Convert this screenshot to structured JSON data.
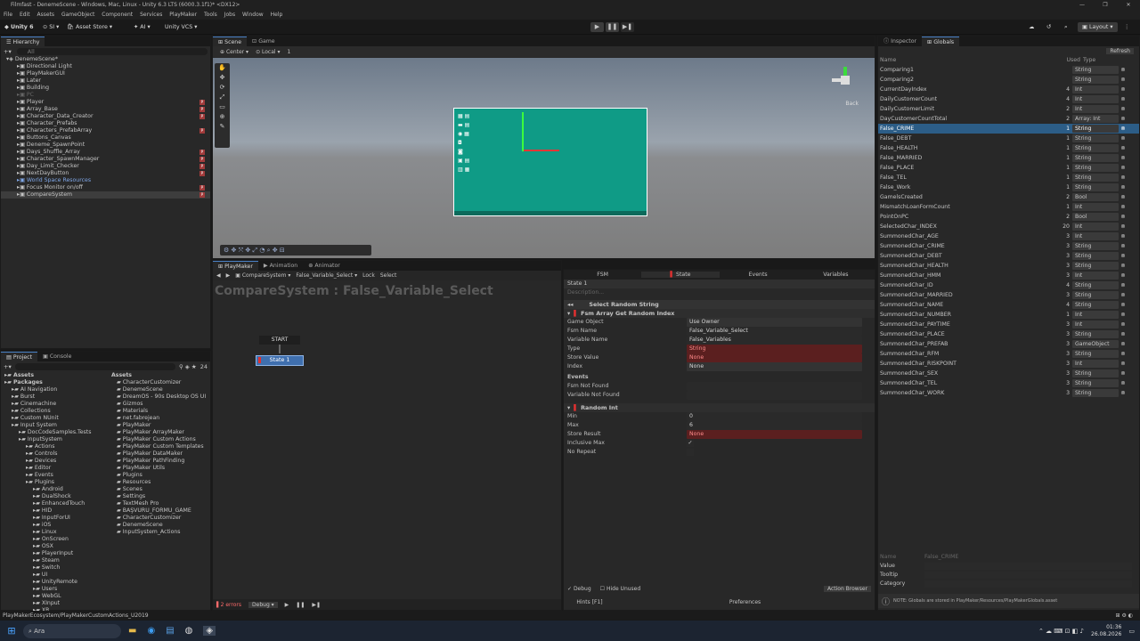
{
  "window": {
    "title": "Filmfast - DenemeScene - Windows, Mac, Linux - Unity 6.3 LTS (6000.3.1f1)* <DX12>",
    "controls": [
      "—",
      "❐",
      "✕"
    ]
  },
  "menu": [
    "File",
    "Edit",
    "Assets",
    "GameObject",
    "Component",
    "Services",
    "PlayMaker",
    "Tools",
    "Jobs",
    "Window",
    "Help"
  ],
  "toolbar": {
    "unity_label": "Unity 6",
    "si_label": "SI",
    "asset_store": "Asset Store",
    "ai_label": "AI",
    "vcs_label": "Unity VCS",
    "layout_label": "Layout"
  },
  "hierarchy": {
    "tab": "Hierarchy",
    "search_placeholder": "All",
    "items": [
      {
        "label": "DenemeScene*",
        "level": 0,
        "pm": false
      },
      {
        "label": "Directional Light",
        "level": 1,
        "pm": false
      },
      {
        "label": "PlayMakerGUI",
        "level": 1,
        "pm": false
      },
      {
        "label": "Later",
        "level": 1,
        "pm": false
      },
      {
        "label": "Building",
        "level": 1,
        "pm": false
      },
      {
        "label": "PC",
        "level": 1,
        "pm": false
      },
      {
        "label": "Player",
        "level": 1,
        "pm": true
      },
      {
        "label": "Array_Base",
        "level": 1,
        "pm": true
      },
      {
        "label": "Character_Data_Creator",
        "level": 1,
        "pm": true
      },
      {
        "label": "Character_Prefabs",
        "level": 1,
        "pm": false
      },
      {
        "label": "Characters_PrefabArray",
        "level": 1,
        "pm": true
      },
      {
        "label": "Buttons_Canvas",
        "level": 1,
        "pm": false
      },
      {
        "label": "Deneme_SpawnPoint",
        "level": 1,
        "pm": false
      },
      {
        "label": "Days_Shuffle_Array",
        "level": 1,
        "pm": true
      },
      {
        "label": "Character_SpawnManager",
        "level": 1,
        "pm": true
      },
      {
        "label": "Day_Limit_Checker",
        "level": 1,
        "pm": true
      },
      {
        "label": "NextDayButton",
        "level": 1,
        "pm": true
      },
      {
        "label": "World Space Resources",
        "level": 1,
        "pm": false
      },
      {
        "label": "Focus Monitor on/off",
        "level": 1,
        "pm": true
      },
      {
        "label": "CompareSystem",
        "level": 1,
        "pm": true
      }
    ]
  },
  "scene": {
    "tabs": [
      "Scene",
      "Game"
    ],
    "pivot": "Center",
    "space": "Local",
    "grid_num": "1",
    "back_label": "Back"
  },
  "playmaker": {
    "tabs": [
      "PlayMaker",
      "Animation",
      "Animator"
    ],
    "breadcrumb": [
      "CompareSystem",
      "False_Variable_Select",
      "Lock",
      "Select"
    ],
    "graph_title": "CompareSystem : False_Variable_Select",
    "start_label": "START",
    "state_label": "State 1",
    "errors": "2 errors",
    "debug": "Debug",
    "inspector_tabs": [
      "FSM",
      "State",
      "Events",
      "Variables"
    ],
    "state_name": "State 1",
    "description_placeholder": "Description...",
    "action1_title": "Select Random String",
    "action2_title": "Fsm Array Get Random Index",
    "props": [
      {
        "label": "Game Object",
        "value": "Use Owner",
        "style": "gray"
      },
      {
        "label": "Fsm Name",
        "value": "False_Variable_Select",
        "style": ""
      },
      {
        "label": "Variable Name",
        "value": "False_Variables",
        "style": ""
      },
      {
        "label": "Type",
        "value": "String",
        "style": "red"
      },
      {
        "label": "Store Value",
        "value": "None",
        "style": "red"
      },
      {
        "label": "Index",
        "value": "None",
        "style": "gray"
      }
    ],
    "events_label": "Events",
    "event_props": [
      {
        "label": "Fsm Not Found",
        "value": ""
      },
      {
        "label": "Variable Not Found",
        "value": ""
      }
    ],
    "action3_title": "Random Int",
    "random_props": [
      {
        "label": "Min",
        "value": "0",
        "style": ""
      },
      {
        "label": "Max",
        "value": "6",
        "style": ""
      },
      {
        "label": "Store Result",
        "value": "None",
        "style": "red"
      },
      {
        "label": "Inclusive Max",
        "value": "✓",
        "style": "check"
      },
      {
        "label": "No Repeat",
        "value": "",
        "style": "check"
      }
    ],
    "debug_label": "Debug",
    "hide_unused": "Hide Unused",
    "action_browser": "Action Browser",
    "hints": "Hints [F1]",
    "preferences": "Preferences"
  },
  "project": {
    "tabs": [
      "Project",
      "Console"
    ],
    "count": "24",
    "tree": [
      {
        "label": "Assets",
        "level": 0,
        "bold": true
      },
      {
        "label": "Packages",
        "level": 0,
        "bold": true
      },
      {
        "label": "AI Navigation",
        "level": 1
      },
      {
        "label": "Burst",
        "level": 1
      },
      {
        "label": "Cinemachine",
        "level": 1
      },
      {
        "label": "Collections",
        "level": 1
      },
      {
        "label": "Custom NUnit",
        "level": 1
      },
      {
        "label": "Input System",
        "level": 1
      },
      {
        "label": "DocCodeSamples.Tests",
        "level": 2
      },
      {
        "label": "InputSystem",
        "level": 2
      },
      {
        "label": "Actions",
        "level": 3
      },
      {
        "label": "Controls",
        "level": 3
      },
      {
        "label": "Devices",
        "level": 3
      },
      {
        "label": "Editor",
        "level": 3
      },
      {
        "label": "Events",
        "level": 3
      },
      {
        "label": "Plugins",
        "level": 3
      },
      {
        "label": "Android",
        "level": 4
      },
      {
        "label": "DualShock",
        "level": 4
      },
      {
        "label": "EnhancedTouch",
        "level": 4
      },
      {
        "label": "HID",
        "level": 4
      },
      {
        "label": "InputForUI",
        "level": 4
      },
      {
        "label": "iOS",
        "level": 4
      },
      {
        "label": "Linux",
        "level": 4
      },
      {
        "label": "OnScreen",
        "level": 4
      },
      {
        "label": "OSX",
        "level": 4
      },
      {
        "label": "PlayerInput",
        "level": 4
      },
      {
        "label": "Steam",
        "level": 4
      },
      {
        "label": "Switch",
        "level": 4
      },
      {
        "label": "UI",
        "level": 4
      },
      {
        "label": "UnityRemote",
        "level": 4
      },
      {
        "label": "Users",
        "level": 4
      },
      {
        "label": "WebGL",
        "level": 4
      },
      {
        "label": "XInput",
        "level": 4
      },
      {
        "label": "XR",
        "level": 4
      }
    ],
    "assets_header": "Assets",
    "assets": [
      "CharacterCustomizer",
      "DenemeScene",
      "DreamOS - 90s Desktop OS UI",
      "Gizmos",
      "Materials",
      "net.fabrejean",
      "PlayMaker",
      "PlayMaker ArrayMaker",
      "PlayMaker Custom Actions",
      "PlayMaker Custom Templates",
      "PlayMaker DataMaker",
      "PlayMaker PathFinding",
      "PlayMaker Utils",
      "Plugins",
      "Resources",
      "Scenes",
      "Settings",
      "TextMesh Pro",
      "BAŞVURU_FORMU_GAME",
      "CharacterCustomizer",
      "DenemeScene",
      "InputSystem_Actions"
    ]
  },
  "inspector": {
    "tabs": [
      "Inspector",
      "Globals"
    ],
    "refresh": "Refresh",
    "headers": {
      "name": "Name",
      "used": "Used",
      "type": "Type"
    },
    "globals": [
      {
        "name": "Comparing1",
        "used": "",
        "type": "String"
      },
      {
        "name": "Comparing2",
        "used": "",
        "type": "String"
      },
      {
        "name": "CurrentDayIndex",
        "used": "4",
        "type": "Int"
      },
      {
        "name": "DailyCustomerCount",
        "used": "4",
        "type": "Int"
      },
      {
        "name": "DailyCustomerLimit",
        "used": "2",
        "type": "Int"
      },
      {
        "name": "DayCustomerCountTotal",
        "used": "2",
        "type": "Array: Int"
      },
      {
        "name": "False_CRIME",
        "used": "1",
        "type": "String",
        "selected": true
      },
      {
        "name": "False_DEBT",
        "used": "1",
        "type": "String"
      },
      {
        "name": "False_HEALTH",
        "used": "1",
        "type": "String"
      },
      {
        "name": "False_MARRIED",
        "used": "1",
        "type": "String"
      },
      {
        "name": "False_PLACE",
        "used": "1",
        "type": "String"
      },
      {
        "name": "False_TEL",
        "used": "1",
        "type": "String"
      },
      {
        "name": "False_Work",
        "used": "1",
        "type": "String"
      },
      {
        "name": "GamelsCreated",
        "used": "2",
        "type": "Bool"
      },
      {
        "name": "MismatchLoanFormCount",
        "used": "1",
        "type": "Int"
      },
      {
        "name": "PointOnPC",
        "used": "2",
        "type": "Bool"
      },
      {
        "name": "SelectedChar_INDEX",
        "used": "20",
        "type": "Int"
      },
      {
        "name": "SummonedChar_AGE",
        "used": "3",
        "type": "Int"
      },
      {
        "name": "SummonedChar_CRIME",
        "used": "3",
        "type": "String"
      },
      {
        "name": "SummonedChar_DEBT",
        "used": "3",
        "type": "String"
      },
      {
        "name": "SummonedChar_HEALTH",
        "used": "3",
        "type": "String"
      },
      {
        "name": "SummonedChar_HMM",
        "used": "3",
        "type": "Int"
      },
      {
        "name": "SummonedChar_ID",
        "used": "4",
        "type": "String"
      },
      {
        "name": "SummonedChar_MARRIED",
        "used": "3",
        "type": "String"
      },
      {
        "name": "SummonedChar_NAME",
        "used": "4",
        "type": "String"
      },
      {
        "name": "SummonedChar_NUMBER",
        "used": "1",
        "type": "Int"
      },
      {
        "name": "SummonedChar_PAYTIME",
        "used": "3",
        "type": "Int"
      },
      {
        "name": "SummonedChar_PLACE",
        "used": "3",
        "type": "String"
      },
      {
        "name": "SummonedChar_PREFAB",
        "used": "3",
        "type": "GameObject"
      },
      {
        "name": "SummonedChar_RFM",
        "used": "3",
        "type": "String"
      },
      {
        "name": "SummonedChar_RISKPOINT",
        "used": "3",
        "type": "Int"
      },
      {
        "name": "SummonedChar_SEX",
        "used": "3",
        "type": "String"
      },
      {
        "name": "SummonedChar_TEL",
        "used": "3",
        "type": "String"
      },
      {
        "name": "SummonedChar_WORK",
        "used": "3",
        "type": "String"
      }
    ],
    "detail": {
      "name_label": "Name",
      "name_value": "False_CRIME",
      "value_label": "Value",
      "tooltip_label": "Tooltip",
      "category_label": "Category"
    },
    "note": "NOTE: Globals are stored in PlayMaker/Resources/PlayMakerGlobals.asset"
  },
  "statusbar": {
    "text": "PlayMakerEcosystem/PlayMakerCustomActions_U2019"
  },
  "taskbar": {
    "search": "Ara",
    "time": "01:36",
    "date": "26.08.2026"
  },
  "colors": {
    "accent": "#2c5d87",
    "teal_canvas": "#0f9b86",
    "error_red": "#5b1f1f"
  }
}
